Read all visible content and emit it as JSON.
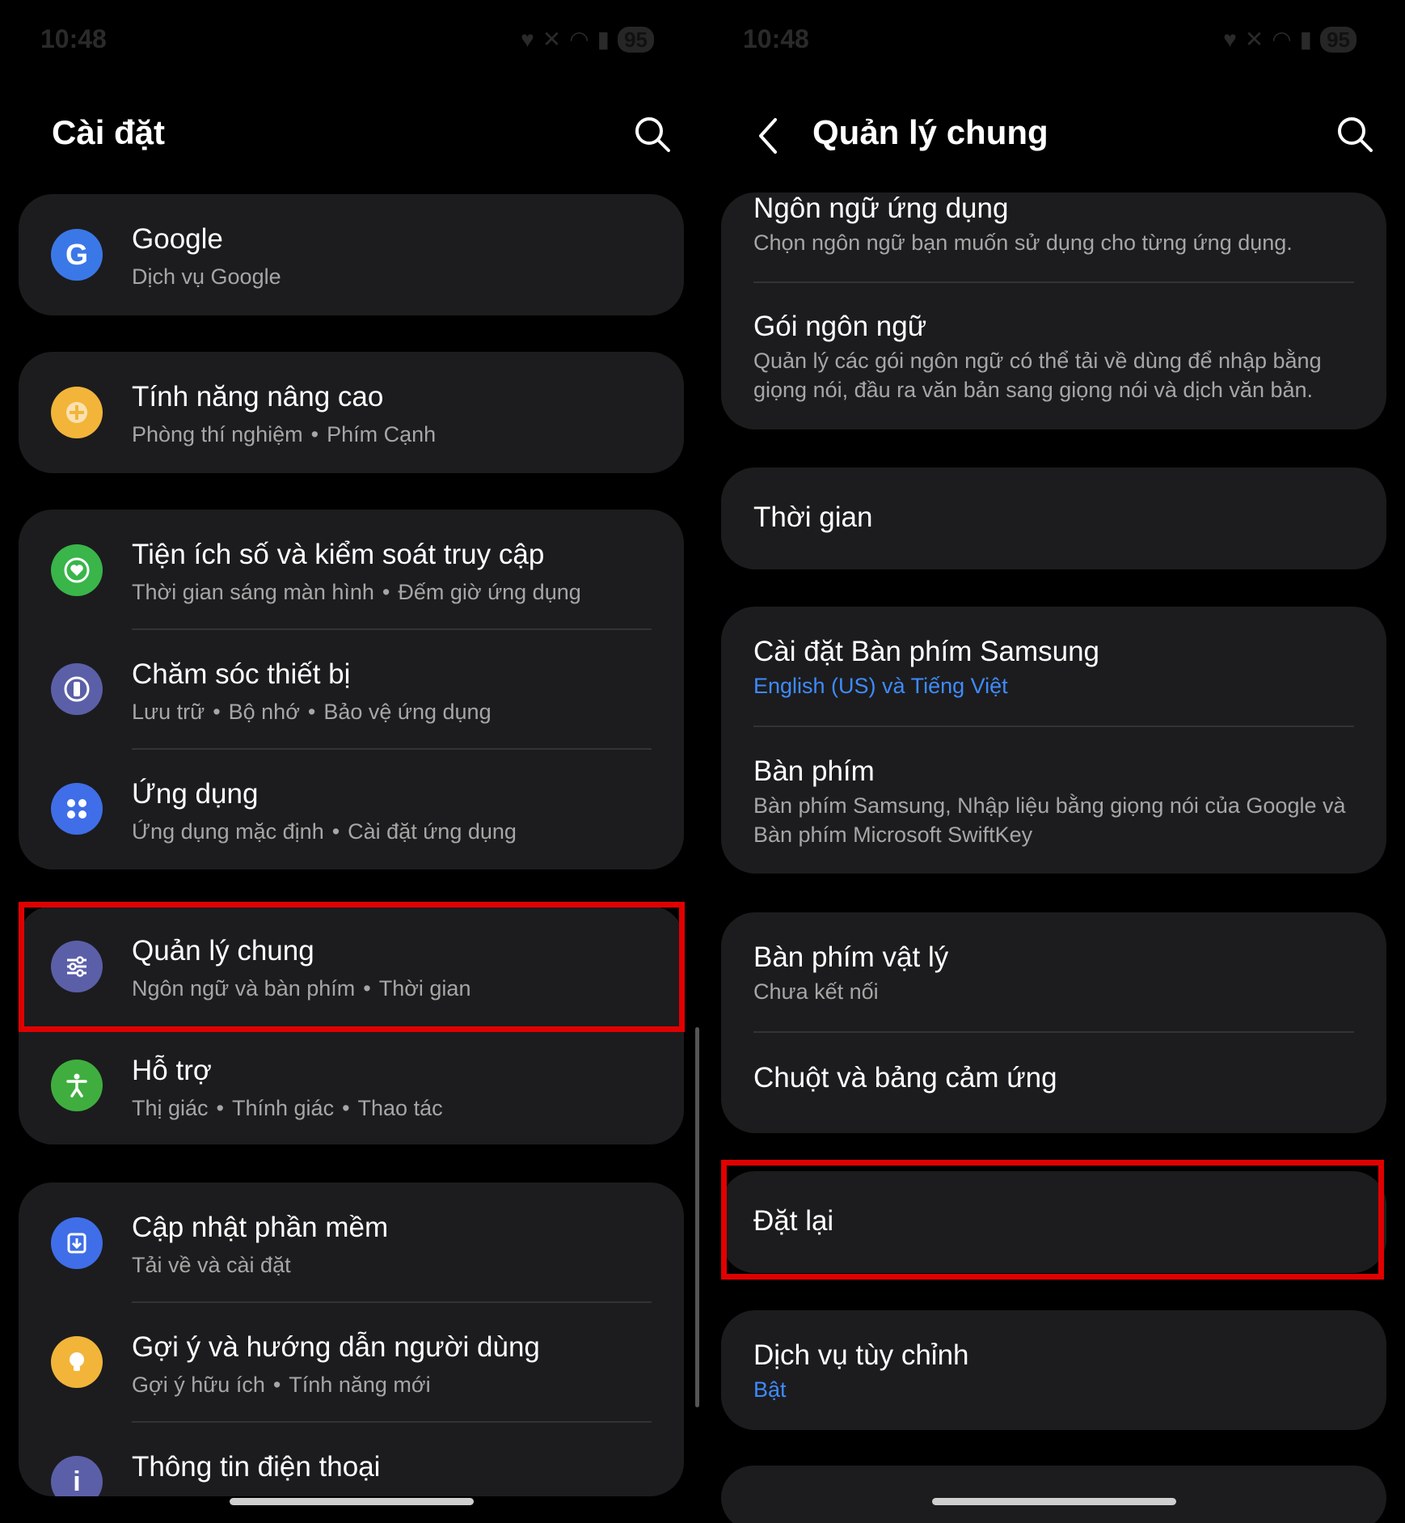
{
  "left": {
    "status": {
      "time": "10:48",
      "battery": "95"
    },
    "header": {
      "title": "Cài đặt"
    },
    "items": [
      {
        "title": "Google",
        "subtitle": "Dịch vụ Google"
      },
      {
        "title": "Tính năng nâng cao",
        "sub1": "Phòng thí nghiệm",
        "sub2": "Phím Cạnh"
      },
      {
        "title": "Tiện ích số và kiểm soát truy cập",
        "sub1": "Thời gian sáng màn hình",
        "sub2": "Đếm giờ ứng dụng"
      },
      {
        "title": "Chăm sóc thiết bị",
        "sub1": "Lưu trữ",
        "sub2": "Bộ nhớ",
        "sub3": "Bảo vệ ứng dụng"
      },
      {
        "title": "Ứng dụng",
        "sub1": "Ứng dụng mặc định",
        "sub2": "Cài đặt ứng dụng"
      },
      {
        "title": "Quản lý chung",
        "sub1": "Ngôn ngữ và bàn phím",
        "sub2": "Thời gian"
      },
      {
        "title": "Hỗ trợ",
        "sub1": "Thị giác",
        "sub2": "Thính giác",
        "sub3": "Thao tác"
      },
      {
        "title": "Cập nhật phần mềm",
        "subtitle": "Tải về và cài đặt"
      },
      {
        "title": "Gợi ý và hướng dẫn người dùng",
        "sub1": "Gợi ý hữu ích",
        "sub2": "Tính năng mới"
      },
      {
        "title": "Thông tin điện thoại"
      }
    ],
    "icon_colors": {
      "google": "#3b78e7",
      "advanced": "#f2b53a",
      "wellbeing": "#39b54a",
      "device_care": "#5b5fa8",
      "apps": "#3f6ee8",
      "general": "#5b5fa8",
      "accessibility": "#3fae3f",
      "update": "#3f6ee8",
      "tips": "#f2b53a",
      "about": "#5b5fa8"
    }
  },
  "right": {
    "status": {
      "time": "10:48",
      "battery": "95"
    },
    "header": {
      "title": "Quản lý chung"
    },
    "items": [
      {
        "title": "Ngôn ngữ ứng dụng",
        "subtitle": "Chọn ngôn ngữ bạn muốn sử dụng cho từng ứng dụng."
      },
      {
        "title": "Gói ngôn ngữ",
        "subtitle": "Quản lý các gói ngôn ngữ có thể tải về dùng để nhập bằng giọng nói, đầu ra văn bản sang giọng nói và dịch văn bản."
      },
      {
        "title": "Thời gian"
      },
      {
        "title": "Cài đặt Bàn phím Samsung",
        "subtitle": "English (US) và Tiếng Việt"
      },
      {
        "title": "Bàn phím",
        "subtitle": "Bàn phím Samsung, Nhập liệu bằng giọng nói của Google và Bàn phím Microsoft SwiftKey"
      },
      {
        "title": "Bàn phím vật lý",
        "subtitle": "Chưa kết nối"
      },
      {
        "title": "Chuột và bảng cảm ứng"
      },
      {
        "title": "Đặt lại"
      },
      {
        "title": "Dịch vụ tùy chỉnh",
        "subtitle": "Bật"
      }
    ]
  },
  "colors": {
    "highlight": "#e00000",
    "link": "#3e8bff",
    "card": "#1c1c1e"
  }
}
